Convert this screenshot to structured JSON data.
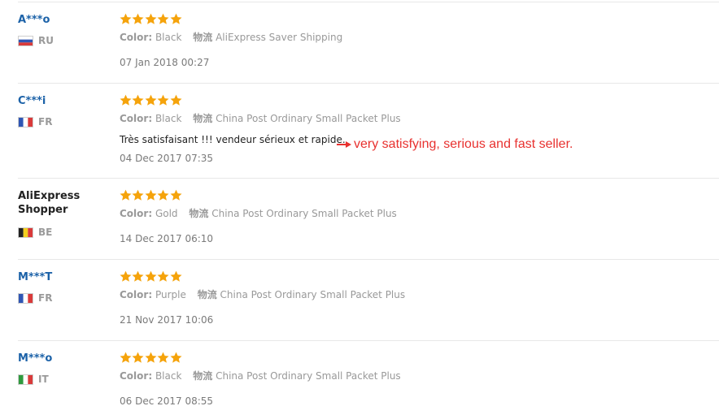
{
  "reviews": [
    {
      "user": "A***o",
      "country": "RU",
      "flag_icon": "russia-flag",
      "rating": 5,
      "color_label": "Color:",
      "color_value": "Black",
      "shipping_label": "物流",
      "shipping_value": "AliExpress Saver Shipping",
      "feedback": "",
      "date": "07 Jan 2018 00:27"
    },
    {
      "user": "C***i",
      "country": "FR",
      "flag_icon": "france-flag",
      "rating": 5,
      "color_label": "Color:",
      "color_value": "Black",
      "shipping_label": "物流",
      "shipping_value": "China Post Ordinary Small Packet Plus",
      "feedback": "Très satisfaisant !!! vendeur sérieux et rapide.",
      "date": "04 Dec 2017 07:35"
    },
    {
      "user": "AliExpress Shopper",
      "country": "BE",
      "flag_icon": "belgium-flag",
      "rating": 5,
      "color_label": "Color:",
      "color_value": "Gold",
      "shipping_label": "物流",
      "shipping_value": "China Post Ordinary Small Packet Plus",
      "feedback": "",
      "date": "14 Dec 2017 06:10"
    },
    {
      "user": "M***T",
      "country": "FR",
      "flag_icon": "france-flag",
      "rating": 5,
      "color_label": "Color:",
      "color_value": "Purple",
      "shipping_label": "物流",
      "shipping_value": "China Post Ordinary Small Packet Plus",
      "feedback": "",
      "date": "21 Nov 2017 10:06"
    },
    {
      "user": "M***o",
      "country": "IT",
      "flag_icon": "italy-flag",
      "rating": 5,
      "color_label": "Color:",
      "color_value": "Black",
      "shipping_label": "物流",
      "shipping_value": "China Post Ordinary Small Packet Plus",
      "feedback": "",
      "date": "06 Dec 2017 08:55"
    }
  ],
  "annotation": {
    "text": "very satisfying, serious and fast seller.",
    "arrow_icon": "red-arrow-icon",
    "color": "#e8312f"
  },
  "colors": {
    "star": "#f5a30b",
    "username": "#1c62a8",
    "muted": "#999999"
  }
}
